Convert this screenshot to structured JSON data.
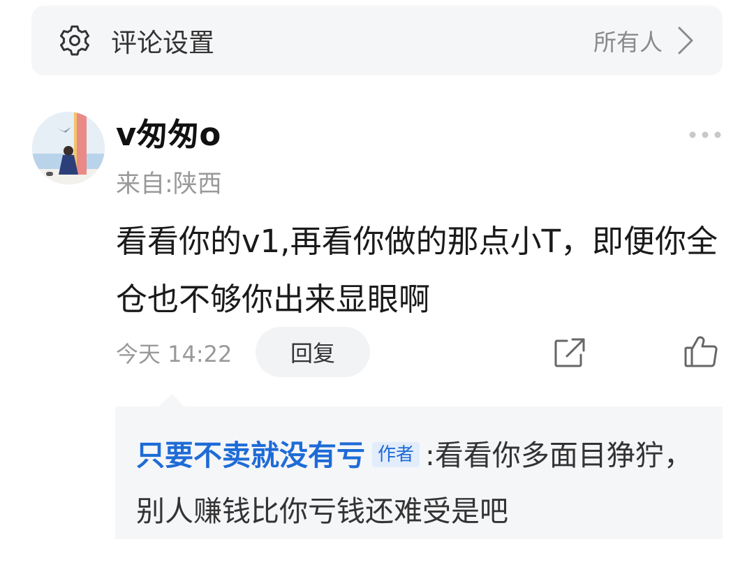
{
  "settings": {
    "title": "评论设置",
    "value": "所有人",
    "icon": "gear-icon"
  },
  "comment": {
    "username": "v匆匆o",
    "location": "来自:陕西",
    "text": "看看你的v1,再看你做的那点小T，即便你全仓也不够你出来显眼啊",
    "time": "今天 14:22",
    "reply_label": "回复"
  },
  "reply": {
    "author": "只要不卖就没有亏",
    "badge": "作者",
    "separator": ":",
    "text": "看看你多面目狰狞，别人赚钱比你亏钱还难受是吧"
  },
  "colors": {
    "accent": "#1e6bd6",
    "panel": "#f5f6f8",
    "muted": "#999999"
  }
}
